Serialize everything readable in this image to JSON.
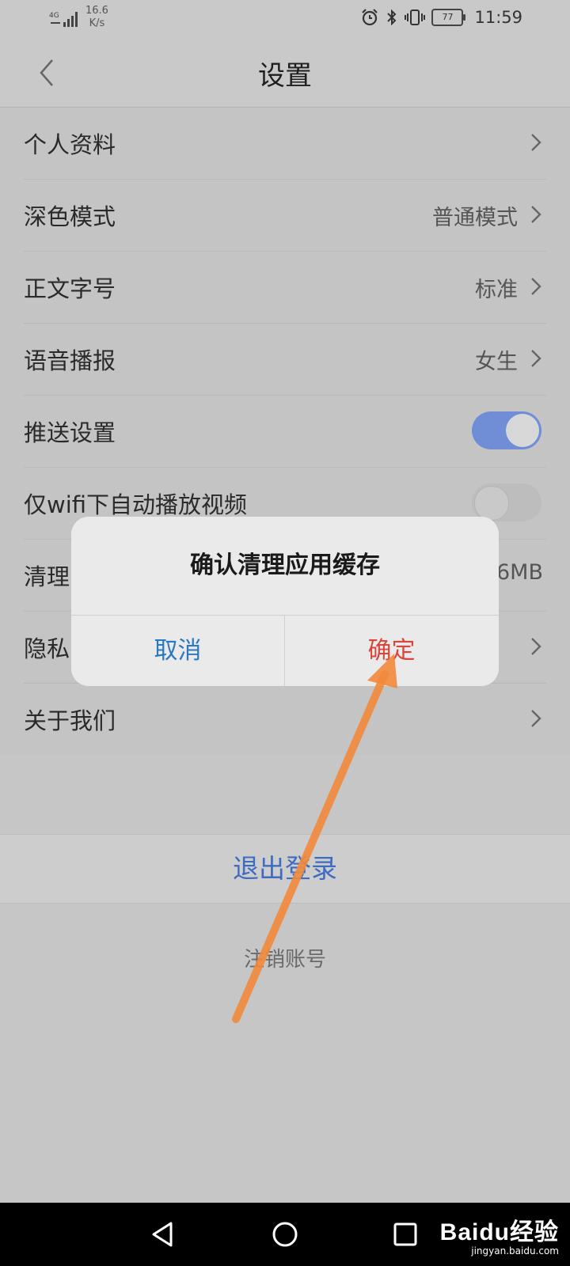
{
  "status_bar": {
    "network": "4G",
    "speed_value": "16.6",
    "speed_unit": "K/s",
    "battery": "77",
    "time": "11:59"
  },
  "header": {
    "title": "设置"
  },
  "settings": {
    "rows": [
      {
        "label": "个人资料",
        "value": ""
      },
      {
        "label": "深色模式",
        "value": "普通模式"
      },
      {
        "label": "正文字号",
        "value": "标准"
      },
      {
        "label": "语音播报",
        "value": "女生"
      },
      {
        "label": "推送设置",
        "toggle": true
      },
      {
        "label": "仅wifi下自动播放视频",
        "toggle": false
      },
      {
        "label": "清理",
        "value": "6MB"
      },
      {
        "label": "隐私",
        "value": ""
      },
      {
        "label": "关于我们",
        "value": ""
      }
    ]
  },
  "actions": {
    "logout": "退出登录",
    "cancel_account": "注销账号"
  },
  "dialog": {
    "title": "确认清理应用缓存",
    "cancel": "取消",
    "confirm": "确定"
  },
  "watermark": {
    "brand": "Baidu经验",
    "url": "jingyan.baidu.com"
  },
  "colors": {
    "accent_blue": "#3d6cc0",
    "toggle_on": "#6f8ed6",
    "confirm_red": "#d8453a",
    "arrow_orange": "#f28a3c"
  }
}
